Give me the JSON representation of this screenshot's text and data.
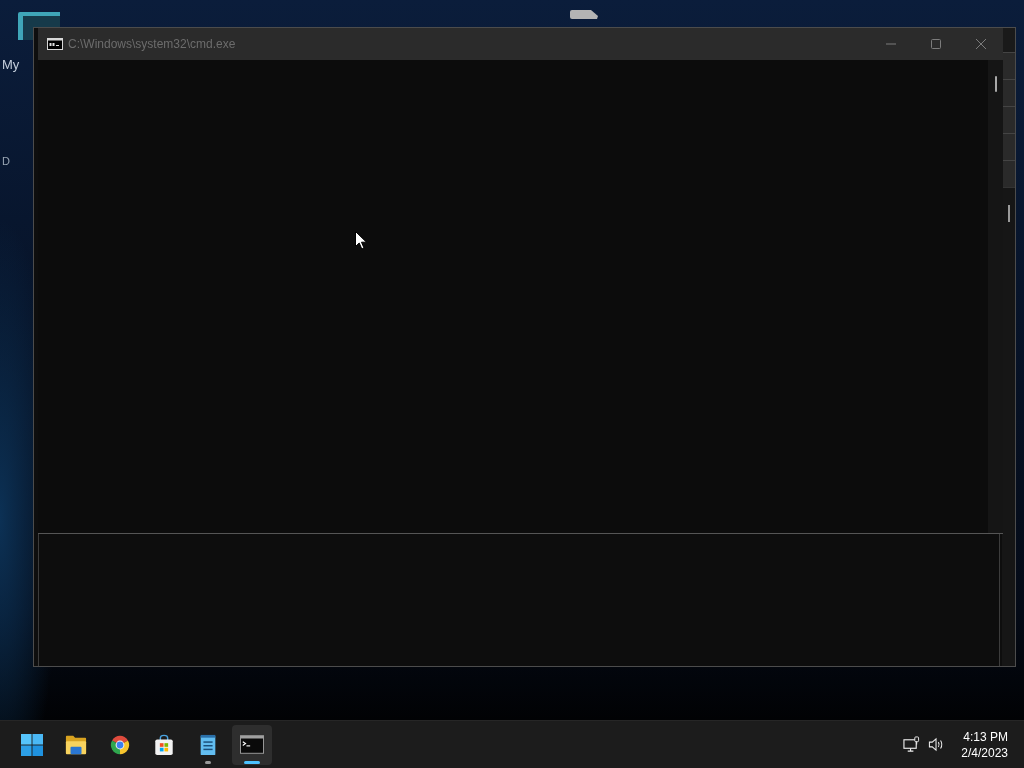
{
  "desktop": {
    "shortcuts": [
      {
        "label": "My"
      },
      {
        "label": "D"
      }
    ]
  },
  "window": {
    "title": "C:\\Windows\\system32\\cmd.exe",
    "active": false,
    "controls": [
      {
        "kind": "minimize"
      },
      {
        "kind": "maximize"
      },
      {
        "kind": "close"
      }
    ]
  },
  "taskbar": {
    "apps": [
      {
        "kind": "start",
        "running": false,
        "selected": false
      },
      {
        "kind": "folder",
        "running": false,
        "selected": false
      },
      {
        "kind": "browser",
        "running": false,
        "selected": false
      },
      {
        "kind": "store",
        "running": false,
        "selected": false
      },
      {
        "kind": "notepad",
        "running": true,
        "selected": false
      },
      {
        "kind": "terminal",
        "running": true,
        "selected": true
      }
    ],
    "tray": [
      {
        "kind": "network"
      },
      {
        "kind": "volume"
      }
    ],
    "clock": {
      "time": "4:13 PM",
      "date": "2/4/2023"
    }
  }
}
